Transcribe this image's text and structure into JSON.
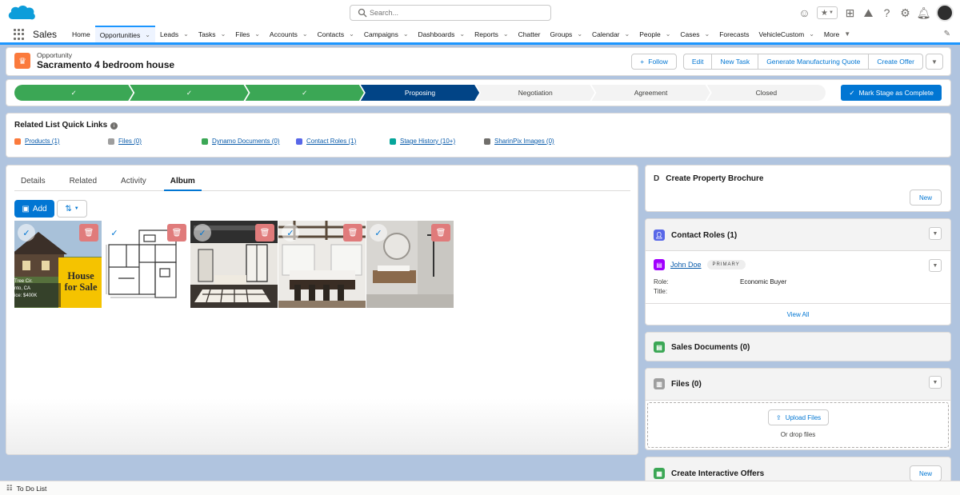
{
  "header": {
    "search_placeholder": "Search..."
  },
  "nav": {
    "app_name": "Sales",
    "items": [
      {
        "label": "Home",
        "has_menu": false
      },
      {
        "label": "Opportunities",
        "has_menu": true,
        "active": true
      },
      {
        "label": "Leads",
        "has_menu": true
      },
      {
        "label": "Tasks",
        "has_menu": true
      },
      {
        "label": "Files",
        "has_menu": true
      },
      {
        "label": "Accounts",
        "has_menu": true
      },
      {
        "label": "Contacts",
        "has_menu": true
      },
      {
        "label": "Campaigns",
        "has_menu": true
      },
      {
        "label": "Dashboards",
        "has_menu": true
      },
      {
        "label": "Reports",
        "has_menu": true
      },
      {
        "label": "Chatter",
        "has_menu": false
      },
      {
        "label": "Groups",
        "has_menu": true
      },
      {
        "label": "Calendar",
        "has_menu": true
      },
      {
        "label": "People",
        "has_menu": true
      },
      {
        "label": "Cases",
        "has_menu": true
      },
      {
        "label": "Forecasts",
        "has_menu": false
      },
      {
        "label": "VehicleCustom",
        "has_menu": true
      },
      {
        "label": "More",
        "has_menu": true
      }
    ]
  },
  "record": {
    "type": "Opportunity",
    "title": "Sacramento 4 bedroom house",
    "actions": {
      "follow": "Follow",
      "edit": "Edit",
      "new_task": "New Task",
      "generate_quote": "Generate Manufacturing Quote",
      "create_offer": "Create Offer"
    }
  },
  "path": {
    "stages": [
      {
        "label": "",
        "status": "complete"
      },
      {
        "label": "",
        "status": "complete"
      },
      {
        "label": "",
        "status": "complete"
      },
      {
        "label": "Proposing",
        "status": "current"
      },
      {
        "label": "Negotiation",
        "status": "incomplete"
      },
      {
        "label": "Agreement",
        "status": "incomplete"
      },
      {
        "label": "Closed",
        "status": "incomplete"
      }
    ],
    "mark_complete": "Mark Stage as Complete"
  },
  "quick_links": {
    "title": "Related List Quick Links",
    "links": [
      {
        "label": "Products (1)",
        "color": "#fb7a3c"
      },
      {
        "label": "Files (0)",
        "color": "#9e9e9e"
      },
      {
        "label": "Dynamo Documents (0)",
        "color": "#3ba755"
      },
      {
        "label": "Contact Roles (1)",
        "color": "#5867e8"
      },
      {
        "label": "Stage History (10+)",
        "color": "#06a59a"
      },
      {
        "label": "SharinPix Images (0)",
        "color": "#706e6b"
      }
    ]
  },
  "main": {
    "tabs": [
      "Details",
      "Related",
      "Activity",
      "Album"
    ],
    "active_tab": "Album",
    "add_label": "Add",
    "flyer": {
      "line1": "House",
      "line2": "for Sale",
      "address_lines": [
        "Tree Cir.",
        "nto, CA",
        "ice: $400K"
      ]
    }
  },
  "side": {
    "brochure": {
      "title": "Create Property Brochure",
      "new_label": "New"
    },
    "contact_roles": {
      "title": "Contact Roles (1)",
      "contact_name": "John Doe",
      "badge": "PRIMARY",
      "role_label": "Role:",
      "role_value": "Economic Buyer",
      "title_label": "Title:",
      "view_all": "View All"
    },
    "sales_docs": {
      "title": "Sales Documents (0)"
    },
    "files": {
      "title": "Files (0)",
      "upload": "Upload Files",
      "drop": "Or drop files"
    },
    "offers": {
      "title": "Create Interactive Offers",
      "new_label": "New"
    }
  },
  "footer": {
    "todo": "To Do List"
  },
  "colors": {
    "brand": "#0176d3",
    "complete": "#3ba755",
    "current": "#014486"
  }
}
